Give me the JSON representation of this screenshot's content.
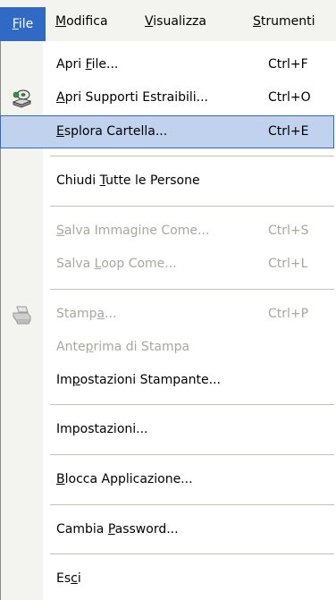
{
  "menubar": {
    "items": [
      {
        "pre": "",
        "key": "F",
        "post": "ile"
      },
      {
        "pre": "",
        "key": "M",
        "post": "odifica"
      },
      {
        "pre": "",
        "key": "V",
        "post": "isualizza"
      },
      {
        "pre": "",
        "key": "S",
        "post": "trumenti"
      }
    ]
  },
  "menu": {
    "items": [
      {
        "pre": "Apri ",
        "key": "F",
        "post": "ile...",
        "shortcut": "Ctrl+F",
        "icon": "",
        "enabled": true
      },
      {
        "pre": "",
        "key": "A",
        "post": "pri Supporti Estraibili...",
        "shortcut": "Ctrl+O",
        "icon": "removable-media-icon",
        "enabled": true
      },
      {
        "pre": "",
        "key": "E",
        "post": "splora Cartella...",
        "shortcut": "Ctrl+E",
        "icon": "",
        "enabled": true,
        "highlighted": true
      },
      {
        "pre": "Chiudi ",
        "key": "T",
        "post": "utte le Persone",
        "shortcut": "",
        "icon": "",
        "enabled": true
      },
      {
        "pre": "",
        "key": "S",
        "post": "alva Immagine Come...",
        "shortcut": "Ctrl+S",
        "icon": "",
        "enabled": false
      },
      {
        "pre": "Salva ",
        "key": "L",
        "post": "oop Come...",
        "shortcut": "Ctrl+L",
        "icon": "",
        "enabled": false
      },
      {
        "pre": "Stamp",
        "key": "a",
        "post": "...",
        "shortcut": "Ctrl+P",
        "icon": "printer-icon",
        "enabled": false
      },
      {
        "pre": "Ante",
        "key": "p",
        "post": "rima di Stampa",
        "shortcut": "",
        "icon": "",
        "enabled": false
      },
      {
        "pre": "Im",
        "key": "p",
        "post": "ostazioni Stampante...",
        "shortcut": "",
        "icon": "",
        "enabled": true
      },
      {
        "pre": "Impostazioni...",
        "key": "",
        "post": "",
        "shortcut": "",
        "icon": "",
        "enabled": true
      },
      {
        "pre": "",
        "key": "B",
        "post": "locca Applicazione...",
        "shortcut": "",
        "icon": "",
        "enabled": true
      },
      {
        "pre": "Cambia ",
        "key": "P",
        "post": "assword...",
        "shortcut": "",
        "icon": "",
        "enabled": true
      },
      {
        "pre": "Es",
        "key": "c",
        "post": "i",
        "shortcut": "",
        "icon": "",
        "enabled": true
      }
    ]
  },
  "colors": {
    "highlight_bg": "#c1d2ee",
    "highlight_border": "#316ac5",
    "active_menu_bg": "#316ac5",
    "disabled_text": "#a8a8a0",
    "icon_column": "#f3f3ef"
  }
}
